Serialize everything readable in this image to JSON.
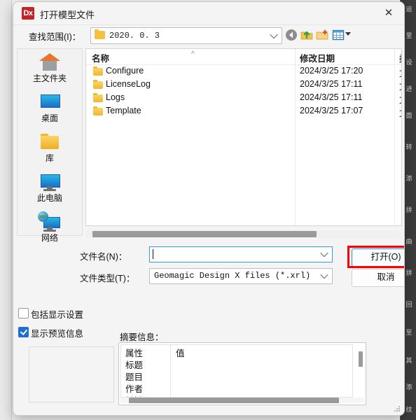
{
  "window": {
    "title": "打开模型文件",
    "app_icon_text": "Dx",
    "close_label": "✕"
  },
  "lookin": {
    "label": "查找范围(I)：",
    "path_value": "2020. 0. 3",
    "toolbar": [
      {
        "name": "back-icon",
        "tooltip": "后退"
      },
      {
        "name": "up-folder-icon",
        "tooltip": "向上一级"
      },
      {
        "name": "new-folder-icon",
        "tooltip": "新建文件夹"
      },
      {
        "name": "views-icon",
        "tooltip": "视图"
      }
    ]
  },
  "places": [
    {
      "label": "主文件夹",
      "icon": "home-icon"
    },
    {
      "label": "桌面",
      "icon": "desktop-icon"
    },
    {
      "label": "库",
      "icon": "library-folder-icon"
    },
    {
      "label": "此电脑",
      "icon": "this-pc-icon"
    },
    {
      "label": "网络",
      "icon": "network-icon"
    }
  ],
  "file_list": {
    "columns": [
      "名称",
      "修改日期",
      "类"
    ],
    "sort_indicator": "^",
    "rows": [
      {
        "name": "Configure",
        "date": "2024/3/25 17:20",
        "type": "文"
      },
      {
        "name": "LicenseLog",
        "date": "2024/3/25 17:11",
        "type": "文"
      },
      {
        "name": "Logs",
        "date": "2024/3/25 17:11",
        "type": "文"
      },
      {
        "name": "Template",
        "date": "2024/3/25 17:07",
        "type": "文"
      }
    ]
  },
  "form": {
    "filename_label": "文件名(N)：",
    "filename_value": "",
    "filetype_label": "文件类型(T)：",
    "filetype_value": "Geomagic Design X files (*.xrl)"
  },
  "buttons": {
    "open": "打开(O)",
    "cancel": "取消"
  },
  "options": {
    "include_display_settings": {
      "label": "包括显示设置",
      "checked": false
    },
    "show_preview_info": {
      "label": "显示预览信息",
      "checked": true
    }
  },
  "summary": {
    "label": "摘要信息：",
    "columns": [
      "属性",
      "值"
    ],
    "rows": [
      {
        "key": "标题",
        "value": ""
      },
      {
        "key": "题目",
        "value": ""
      },
      {
        "key": "作者",
        "value": ""
      },
      {
        "key": "关键词",
        "value": ""
      }
    ]
  },
  "background": {
    "right_panel_items": [
      "运",
      "里",
      "设",
      "进",
      "面",
      "转",
      "添",
      "拼",
      "曲",
      "拼",
      "回",
      "至",
      "其",
      "添",
      "纹"
    ]
  },
  "colors": {
    "accent": "#1f6fd0",
    "highlight": "#ff0000",
    "brand": "#c0252c",
    "folder": "#f0b72d",
    "dialog_bg": "#f4f4f4"
  }
}
